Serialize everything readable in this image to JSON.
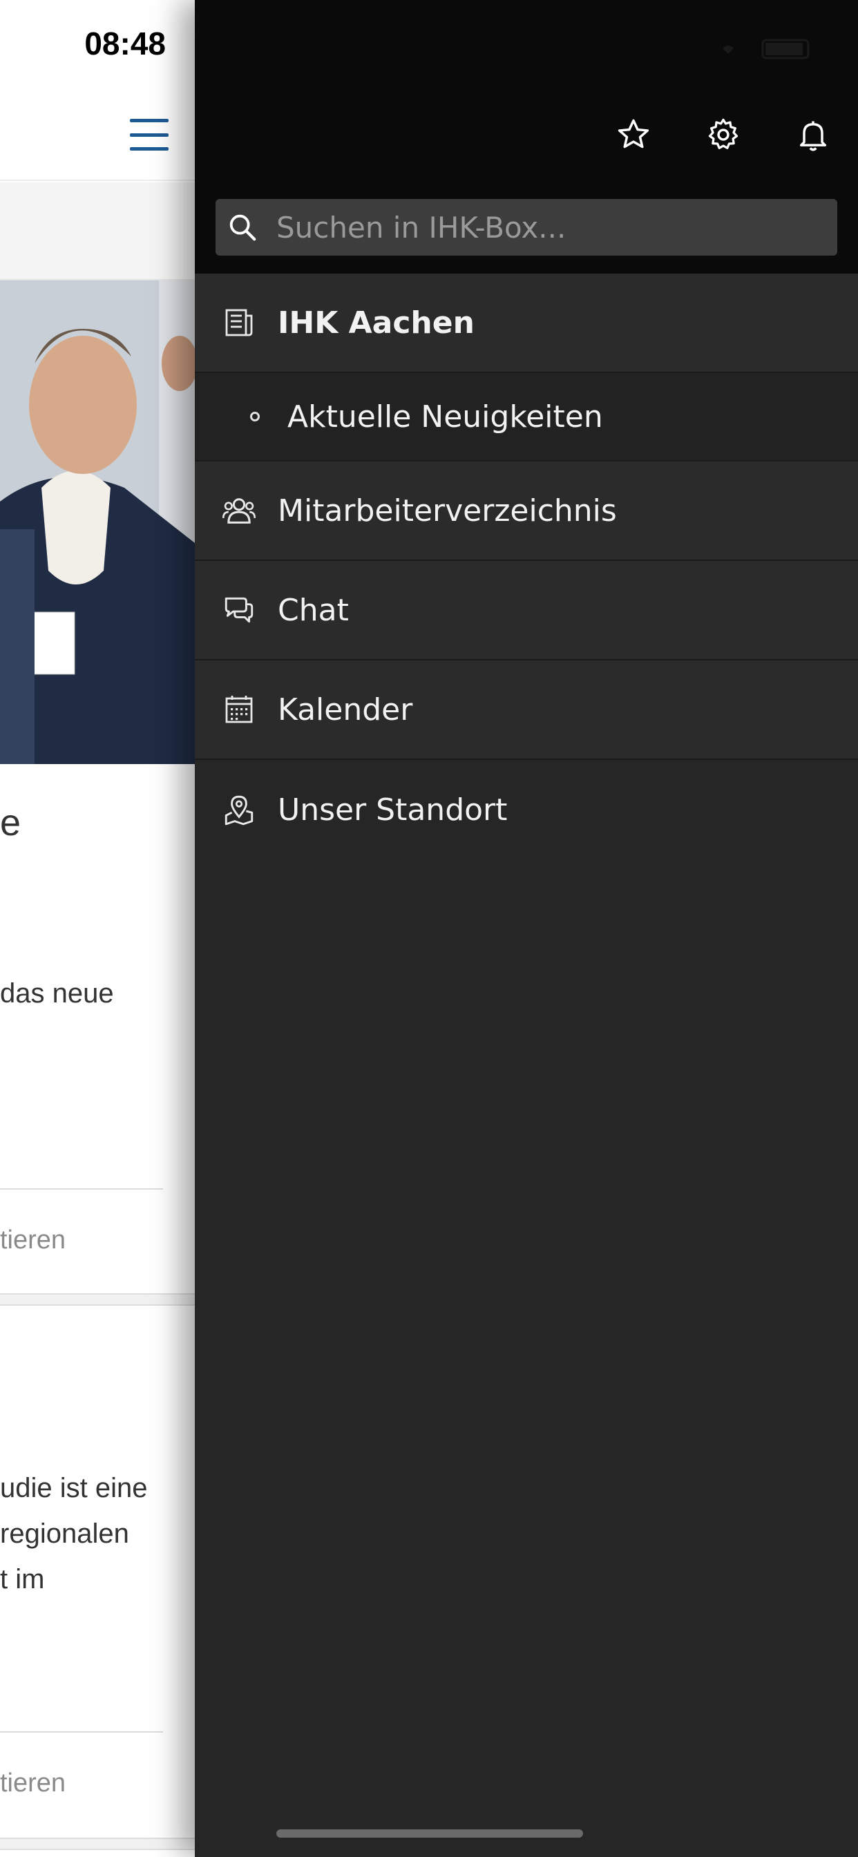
{
  "status": {
    "time": "08:48"
  },
  "behind": {
    "text_1": "e",
    "text_2": "das neue",
    "action_1": "tieren",
    "text_3a": "udie ist eine",
    "text_3b": "regionalen",
    "text_3c": "t im",
    "action_2": "tieren"
  },
  "drawer": {
    "search_placeholder": "Suchen in IHK-Box...",
    "icons": {
      "favorites": "star-icon",
      "settings": "gear-icon",
      "notifications": "bell-icon"
    },
    "menu": [
      {
        "label": "IHK Aachen",
        "icon": "news-icon",
        "bold": true
      },
      {
        "label": "Aktuelle Neuigkeiten",
        "icon": "bullet",
        "sub": true
      },
      {
        "label": "Mitarbeiterverzeichnis",
        "icon": "people-icon"
      },
      {
        "label": "Chat",
        "icon": "chat-icon"
      },
      {
        "label": "Kalender",
        "icon": "calendar-icon"
      },
      {
        "label": "Unser Standort",
        "icon": "map-pin-icon"
      }
    ]
  },
  "colors": {
    "drawer_bg": "#262626",
    "drawer_top": "#0a0a0a",
    "accent": "#1d5a94"
  }
}
